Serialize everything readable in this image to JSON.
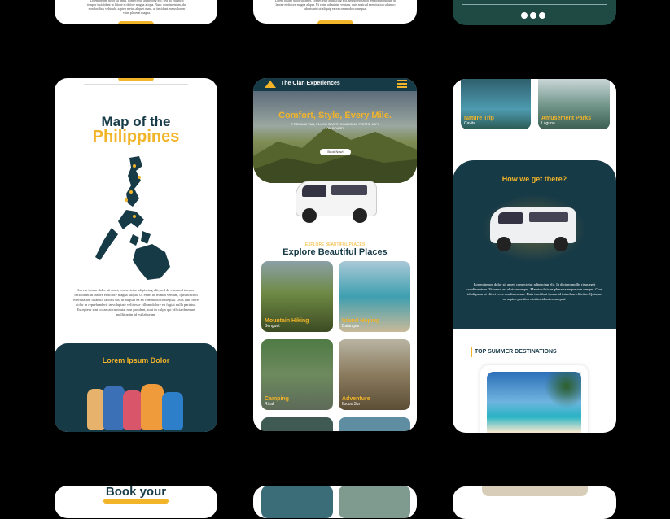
{
  "map_card": {
    "title_line1": "Map of the",
    "title_line2": "Philippines",
    "paragraph": "Lorem ipsum dolor sit amet, consectetur adipiscing elit, sed do eiusmod tempor incididunt ut labore et dolore magna aliqua. Ut enim ad minim veniam, quis nostrud exercitation ullamco laboris nisi ut aliquip ex ea commodo consequat. Duis aute irure dolor in reprehenderit in voluptate velit esse cillum dolore eu fugiat nulla pariatur. Excepteur sint occaecat cupidatat non proident, sunt in culpa qui officia deserunt mollit anim id est laborum.",
    "section_title": "Lorem Ipsum Dolor"
  },
  "main_card": {
    "brand": "The Clan Experiences",
    "hero_title": "Comfort, Style, Every Mile.",
    "hero_sub": "PREMIUM VAN, PLUSH SEATS, CHARGING PORTS, WIFI ON BOARD",
    "hero_button": "Book Now!",
    "eyebrow": "EXPLORE BEAUTIFUL PLACES",
    "section_title": "Explore Beautiful Places",
    "places": [
      {
        "name": "Mountain Hiking",
        "loc": "Benguet"
      },
      {
        "name": "Island Hoping",
        "loc": "Batangas"
      },
      {
        "name": "Camping",
        "loc": "Rizal"
      },
      {
        "name": "Adventure",
        "loc": "Ilocos Sur"
      }
    ]
  },
  "right_card": {
    "tiles": [
      {
        "name": "Nature Trip",
        "loc": "Cavite"
      },
      {
        "name": "Amusement Parks",
        "loc": "Laguna"
      }
    ],
    "section_title": "How we get there?",
    "paragraph": "Lorem ipsum dolor sit amet, consectetur adipiscing elit. In dictum mollis risus eget condimentum. Vivamus eu ultricies neque. Mauris ultricies pharetra neque non semper. Cras id aliquam ut elit viverra condimentum. Duis tincidunt ipsum id interdum efficitur. Quisque ac sapien porttitor nisi tincidunt consequat.",
    "destinations_title": "TOP SUMMER DESTINATIONS"
  },
  "top_row": {
    "left_text": "Lorem ipsum dolor sit amet, consectetur adipiscing elit, sed do eiusmod tempor incididunt ut labore et dolore magna aliqua. Nunc condimentum, dui non facilisis vehicula, sapien metus aliquet nunc, ut tincidunt metus lorem vitae placerat magna.",
    "mid_text": "Lorem ipsum dolor sit amet, consectetur adipiscing elit, sed do eiusmod tempor incididunt ut labore et dolore magna aliqua. Ut enim ad minim veniam, quis nostrud exercitation ullamco laboris nisi ut aliquip ex ea commodo consequat."
  },
  "bottom_row": {
    "left_heading": "Book your"
  },
  "colors": {
    "navy": "#173a47",
    "accent": "#f2b429"
  }
}
